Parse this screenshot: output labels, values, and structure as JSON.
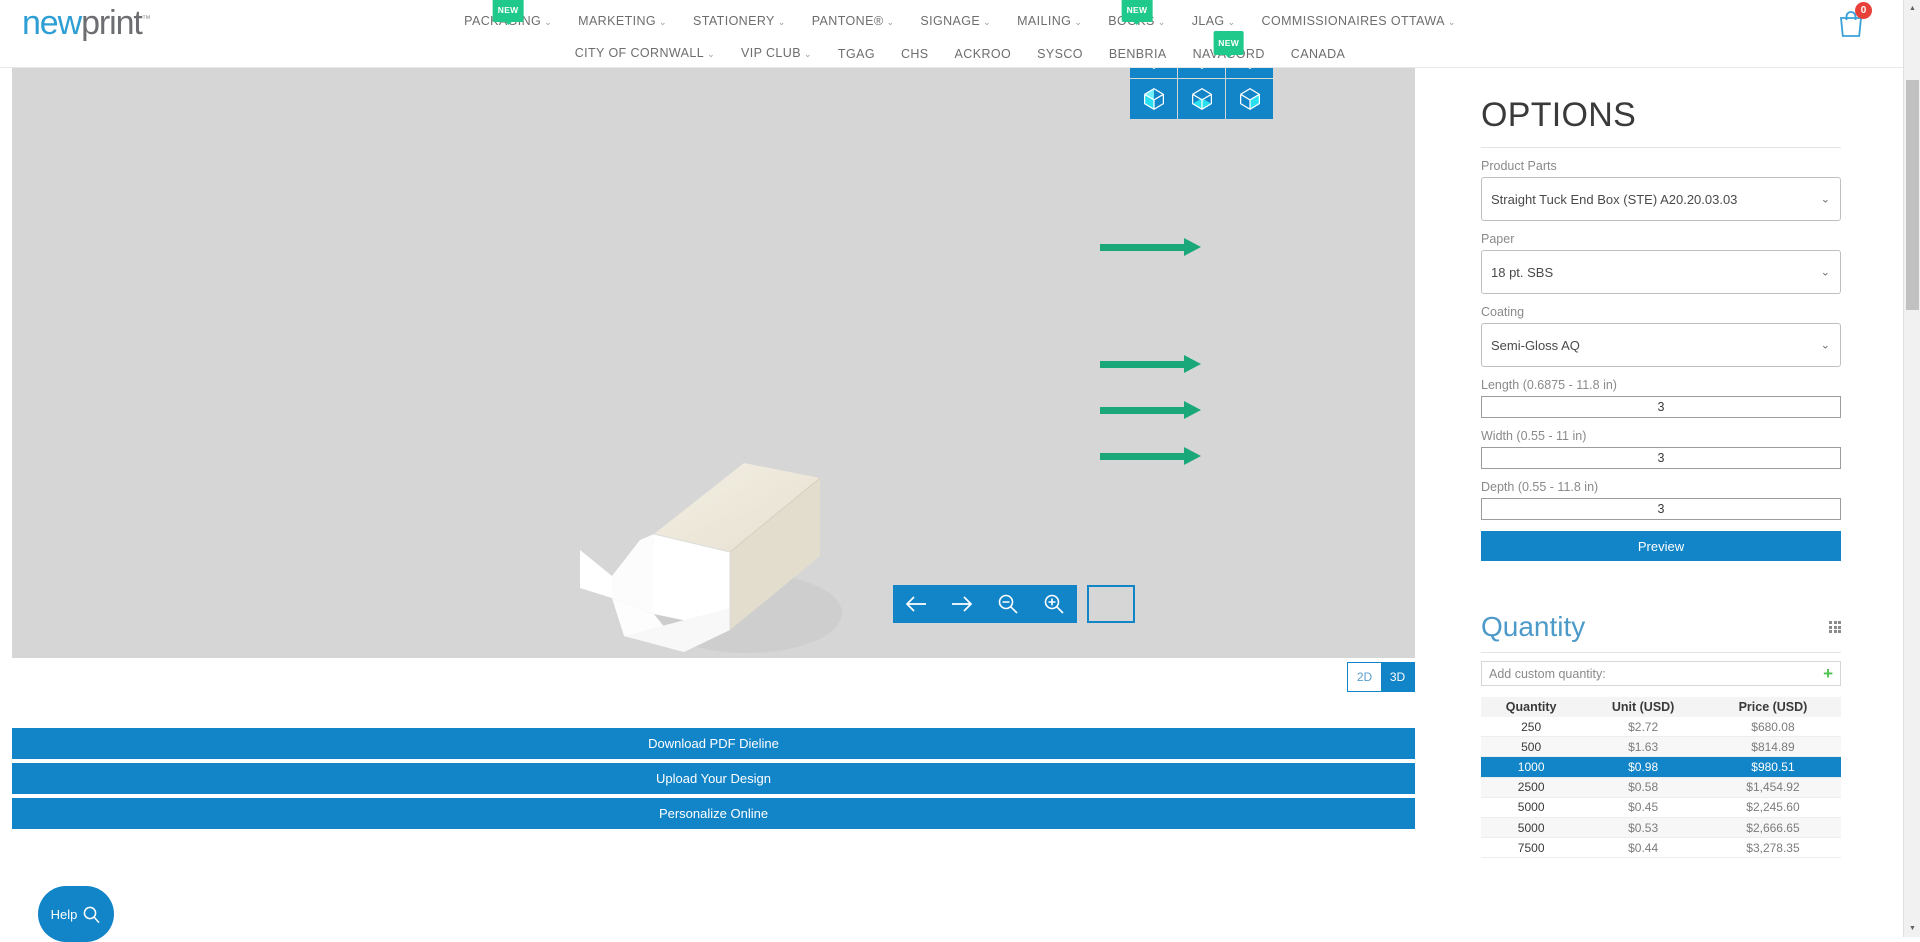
{
  "brand": {
    "name_part1": "new",
    "name_part2": "print",
    "tm": "™"
  },
  "header": {
    "nav_row1": [
      {
        "label": "PACKAGING",
        "caret": true,
        "badge": "NEW"
      },
      {
        "label": "MARKETING",
        "caret": true,
        "badge": null
      },
      {
        "label": "STATIONERY",
        "caret": true,
        "badge": null
      },
      {
        "label": "PANTONE®",
        "caret": true,
        "badge": null
      },
      {
        "label": "SIGNAGE",
        "caret": true,
        "badge": null
      },
      {
        "label": "MAILING",
        "caret": true,
        "badge": null
      },
      {
        "label": "BOOKS",
        "caret": true,
        "badge": "NEW"
      },
      {
        "label": "JLAG",
        "caret": true,
        "badge": null
      },
      {
        "label": "COMMISSIONAIRES OTTAWA",
        "caret": true,
        "badge": null
      }
    ],
    "nav_row2": [
      {
        "label": "CITY OF CORNWALL",
        "caret": true,
        "badge": null
      },
      {
        "label": "VIP CLUB",
        "caret": true,
        "badge": null
      },
      {
        "label": "TGAG",
        "caret": false,
        "badge": null
      },
      {
        "label": "CHS",
        "caret": false,
        "badge": null
      },
      {
        "label": "ACKROO",
        "caret": false,
        "badge": null
      },
      {
        "label": "SYSCO",
        "caret": false,
        "badge": null
      },
      {
        "label": "BENBRIA",
        "caret": false,
        "badge": null
      },
      {
        "label": "NAVACORD",
        "caret": false,
        "badge": "NEW"
      },
      {
        "label": "CANADA",
        "caret": false,
        "badge": null
      }
    ],
    "cart_count": "0"
  },
  "viewer": {
    "cube_buttons": 6,
    "controls": [
      {
        "name": "rotate-left",
        "glyph": "←"
      },
      {
        "name": "rotate-right",
        "glyph": "→"
      },
      {
        "name": "zoom-out",
        "glyph": "zoom-out"
      },
      {
        "name": "zoom-in",
        "glyph": "zoom-in"
      }
    ],
    "dim_toggle": {
      "option_2d": "2D",
      "option_3d": "3D",
      "selected": "3D"
    }
  },
  "actions": [
    {
      "label": "Download PDF Dieline"
    },
    {
      "label": "Upload Your Design"
    },
    {
      "label": "Personalize Online"
    }
  ],
  "help": {
    "label": "Help"
  },
  "options": {
    "title": "OPTIONS",
    "fields": [
      {
        "label": "Product Parts",
        "value": "Straight Tuck End Box (STE) A20.20.03.03",
        "type": "select"
      },
      {
        "label": "Paper",
        "value": "18 pt. SBS",
        "type": "select"
      },
      {
        "label": "Coating",
        "value": "Semi-Gloss AQ",
        "type": "select"
      },
      {
        "label": "Length (0.6875 - 11.8 in)",
        "value": "3",
        "type": "number"
      },
      {
        "label": "Width (0.55 - 11 in)",
        "value": "3",
        "type": "number"
      },
      {
        "label": "Depth (0.55 - 11.8 in)",
        "value": "3",
        "type": "number"
      }
    ],
    "preview_label": "Preview"
  },
  "quantity": {
    "title": "Quantity",
    "custom_label": "Add custom quantity:",
    "columns": [
      "Quantity",
      "Unit (USD)",
      "Price (USD)"
    ],
    "rows": [
      {
        "qty": "250",
        "unit": "$2.72",
        "price": "$680.08",
        "selected": false
      },
      {
        "qty": "500",
        "unit": "$1.63",
        "price": "$814.89",
        "selected": false
      },
      {
        "qty": "1000",
        "unit": "$0.98",
        "price": "$980.51",
        "selected": true
      },
      {
        "qty": "2500",
        "unit": "$0.58",
        "price": "$1,454.92",
        "selected": false
      },
      {
        "qty": "5000",
        "unit": "$0.45",
        "price": "$2,245.60",
        "selected": false
      },
      {
        "qty": "5000",
        "unit": "$0.53",
        "price": "$2,666.65",
        "selected": false
      },
      {
        "qty": "7500",
        "unit": "$0.44",
        "price": "$3,278.35",
        "selected": false
      }
    ]
  },
  "colors": {
    "brand_blue": "#1284c8",
    "logo_blue": "#2e9fd4",
    "arrow_green": "#1aa87a",
    "badge_green": "#1ec98b",
    "cart_red": "#e8413a",
    "viewer_bg": "#d6d6d6"
  }
}
